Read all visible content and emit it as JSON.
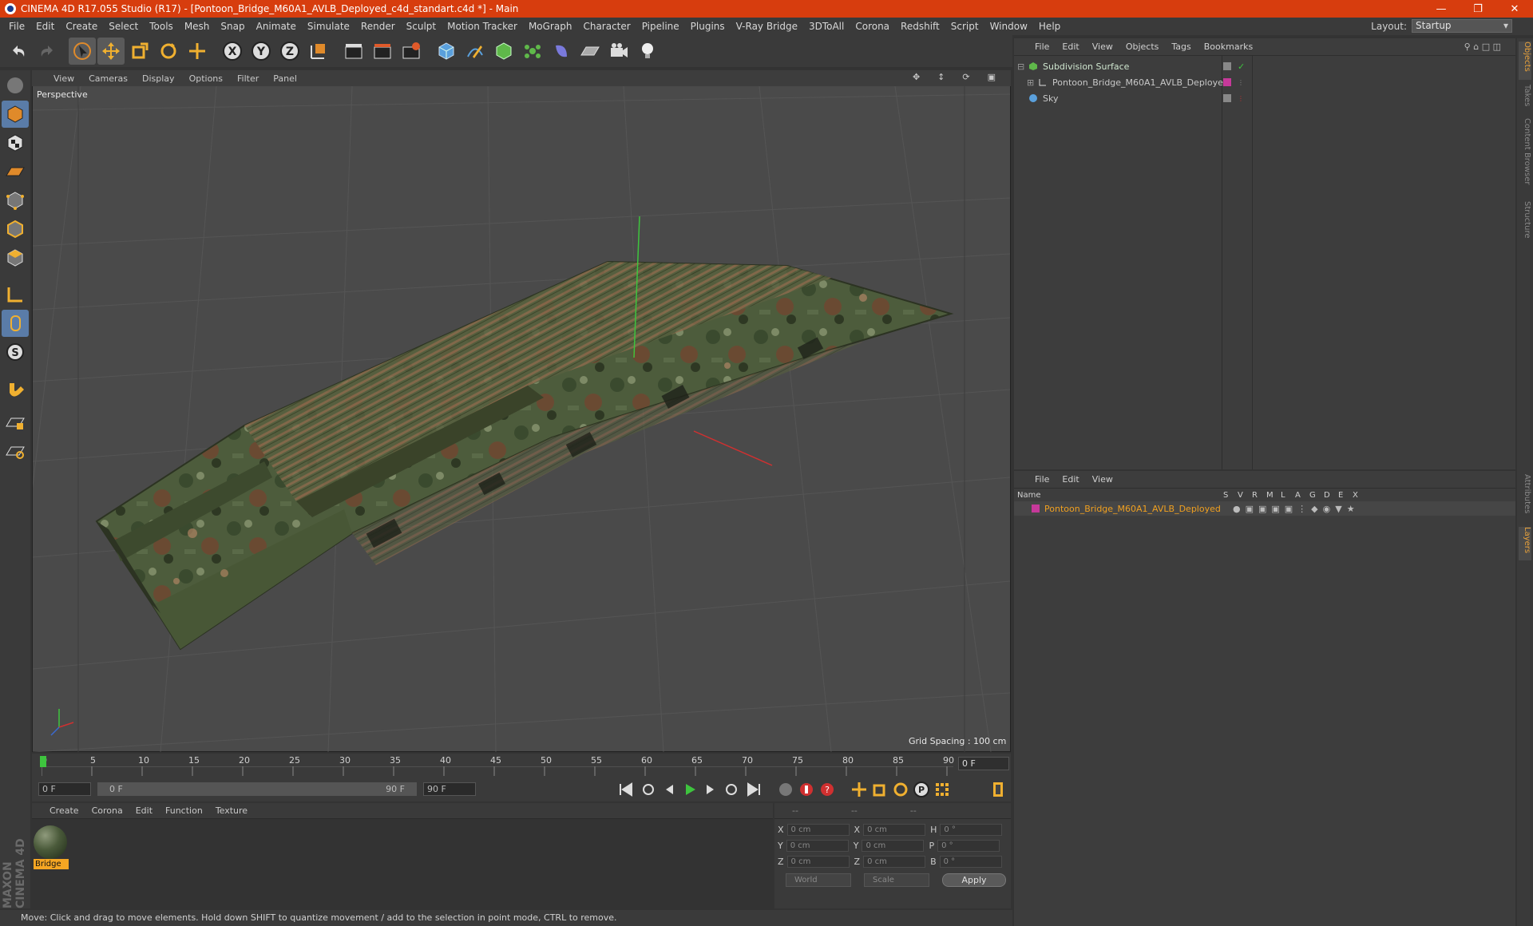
{
  "window": {
    "title": "CINEMA 4D R17.055 Studio (R17) - [Pontoon_Bridge_M60A1_AVLB_Deployed_c4d_standart.c4d *] - Main"
  },
  "menubar": [
    "File",
    "Edit",
    "Create",
    "Select",
    "Tools",
    "Mesh",
    "Snap",
    "Animate",
    "Simulate",
    "Render",
    "Sculpt",
    "Motion Tracker",
    "MoGraph",
    "Character",
    "Pipeline",
    "Plugins",
    "V-Ray Bridge",
    "3DToAll",
    "Corona",
    "Redshift",
    "Script",
    "Window",
    "Help"
  ],
  "layout": {
    "label": "Layout:",
    "value": "Startup"
  },
  "viewport": {
    "menu": [
      "View",
      "Cameras",
      "Display",
      "Options",
      "Filter",
      "Panel"
    ],
    "label": "Perspective",
    "grid_spacing": "Grid Spacing : 100 cm"
  },
  "timeline": {
    "ticks": [
      "0",
      "5",
      "10",
      "15",
      "20",
      "25",
      "30",
      "35",
      "40",
      "45",
      "50",
      "55",
      "60",
      "65",
      "70",
      "75",
      "80",
      "85",
      "90"
    ],
    "current_frame": "0 F"
  },
  "transport": {
    "start": "0 F",
    "range_start": "0 F",
    "range_end": "90 F",
    "end": "90 F"
  },
  "materials": {
    "menu": [
      "Create",
      "Corona",
      "Edit",
      "Function",
      "Texture"
    ],
    "items": [
      {
        "name": "Bridge"
      }
    ]
  },
  "coords": {
    "headers": [
      "--",
      "--",
      "--"
    ],
    "rows": [
      {
        "a": "X",
        "av": "0 cm",
        "b": "X",
        "bv": "0 cm",
        "c": "H",
        "cv": "0 °"
      },
      {
        "a": "Y",
        "av": "0 cm",
        "b": "Y",
        "bv": "0 cm",
        "c": "P",
        "cv": "0 °"
      },
      {
        "a": "Z",
        "av": "0 cm",
        "b": "Z",
        "bv": "0 cm",
        "c": "B",
        "cv": "0 °"
      }
    ],
    "space": "World",
    "mode": "Scale",
    "apply": "Apply"
  },
  "objects": {
    "menu": [
      "File",
      "Edit",
      "View",
      "Objects",
      "Tags",
      "Bookmarks"
    ],
    "items": [
      {
        "name": "Subdivision Surface",
        "color": "#9fd6a0"
      },
      {
        "name": "Pontoon_Bridge_M60A1_AVLB_Deployed",
        "color": "#c8c8c8"
      },
      {
        "name": "Sky",
        "color": "#c8c8c8"
      }
    ]
  },
  "layers": {
    "menu": [
      "File",
      "Edit",
      "View"
    ],
    "header": {
      "name": "Name",
      "cols": [
        "S",
        "V",
        "R",
        "M",
        "L",
        "A",
        "G",
        "D",
        "E",
        "X"
      ]
    },
    "items": [
      {
        "name": "Pontoon_Bridge_M60A1_AVLB_Deployed",
        "color": "#c6399a"
      }
    ]
  },
  "sidetabs": [
    "Objects",
    "Takes",
    "Content Browser",
    "Structure",
    "Attributes",
    "Layers"
  ],
  "status": "Move: Click and drag to move elements. Hold down SHIFT to quantize movement / add to the selection in point mode, CTRL to remove.",
  "brand": "MAXON CINEMA 4D"
}
